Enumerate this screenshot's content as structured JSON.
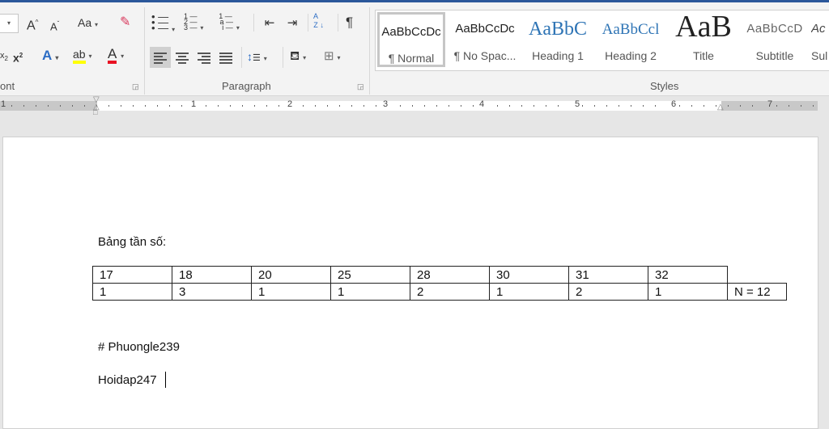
{
  "ribbon": {
    "font": {
      "group_label": "ont",
      "grow": "A",
      "shrink": "A",
      "change_case": "Aa",
      "superscript": "x",
      "superscript_mark": "2",
      "subscript_mark": "2",
      "text_effects": "A",
      "highlight": "ab",
      "font_color": "A",
      "highlight_color": "#ffff00",
      "font_color_value": "#e81123"
    },
    "paragraph": {
      "group_label": "Paragraph",
      "pilcrow": "¶",
      "sort_top": "A",
      "sort_bottom": "Z",
      "bullets_icon": "bullets-icon",
      "numbering_icon": "numbering-icon",
      "multilevel_icon": "multilevel-list-icon"
    },
    "styles": {
      "group_label": "Styles",
      "items": [
        {
          "preview": "AaBbCcDc",
          "name": "¶ Normal",
          "selected": true
        },
        {
          "preview": "AaBbCcDc",
          "name": "¶ No Spac..."
        },
        {
          "preview": "AaBbC",
          "name": "Heading 1"
        },
        {
          "preview": "AaBbCcl",
          "name": "Heading 2"
        },
        {
          "preview": "AaB",
          "name": "Title"
        },
        {
          "preview": "AaBbCcD",
          "name": "Subtitle"
        },
        {
          "preview": "Ac",
          "name": "Sul"
        }
      ]
    }
  },
  "ruler": {
    "numbers": [
      "1",
      "1",
      "2",
      "3",
      "4",
      "5",
      "6",
      "7"
    ]
  },
  "document": {
    "heading": "Bảng tần số:",
    "table": {
      "values": [
        "17",
        "18",
        "20",
        "25",
        "28",
        "30",
        "31",
        "32"
      ],
      "frequencies": [
        "1",
        "3",
        "1",
        "1",
        "2",
        "1",
        "2",
        "1"
      ],
      "total": "N = 12"
    },
    "line1": "# Phuongle239",
    "line2": "Hoidap247"
  }
}
